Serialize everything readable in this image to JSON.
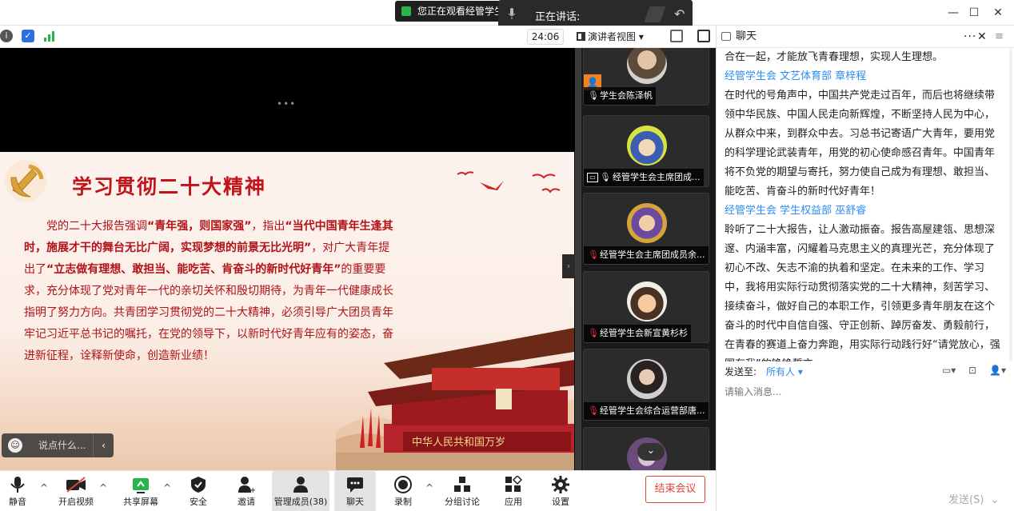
{
  "titlebar": {
    "share_banner": "您正在观看经管学生",
    "speaking_label": "正在讲话:",
    "minimize": "—",
    "maximize": "☐",
    "close": "✕"
  },
  "subbar": {
    "timer": "24:06",
    "speaker_view": "演讲者视图 ▾"
  },
  "slide": {
    "title": "学习贯彻二十大精神",
    "paragraph": [
      {
        "t": "党的二十大报告强调",
        "b": false
      },
      {
        "t": "“青年强，则国家强”",
        "b": true
      },
      {
        "t": "，指出",
        "b": false
      },
      {
        "t": "“当代中国青年生逢其时，施展才干的舞台无比广阔，实现梦想的前景无比光明”",
        "b": true
      },
      {
        "t": "，对广大青年提出了",
        "b": false
      },
      {
        "t": "“立志做有理想、敢担当、能吃苦、肯奋斗的新时代好青年”",
        "b": true
      },
      {
        "t": "的重要要求，充分体现了党对青年一代的亲切关怀和殷切期待，为青年一代健康成长指明了努力方向。共青团学习贯彻党的二十大精神，必须引导广大团员青年牢记习近平总书记的嘱托，在党的领导下，以新时代好青年应有的姿态，奋进新征程，诠释新使命，创造新业绩！",
        "b": false
      }
    ],
    "gate_banner": "中华人民共和国万岁"
  },
  "comment_box": {
    "placeholder": "说点什么...",
    "arrow": "‹"
  },
  "gallery": {
    "participants": [
      {
        "name": "学生会陈泽帆",
        "mic": "on"
      },
      {
        "name": "经管学生会主席团成...",
        "mic": "on"
      },
      {
        "name": "经管学生会主席团成员余...",
        "mic": "off"
      },
      {
        "name": "经管学生会新宣黄杉杉",
        "mic": "off"
      },
      {
        "name": "经管学生会综合运营部唐...",
        "mic": "off"
      }
    ],
    "scroll_down": "⌄"
  },
  "chat": {
    "title": "聊天",
    "messages": [
      {
        "sender": "",
        "text": "合在一起，才能放飞青春理想，实现人生理想。"
      },
      {
        "sender": "经管学生会 文艺体育部 章梓程",
        "text": "在时代的号角声中，中国共产党走过百年，而后也将继续带领中华民族、中国人民走向新辉煌，不断坚持人民为中心，从群众中来，到群众中去。习总书记寄语广大青年，要用党的科学理论武装青年，用党的初心使命感召青年。中国青年将不负党的期望与寄托，努力使自己成为有理想、敢担当、能吃苦、肯奋斗的新时代好青年！"
      },
      {
        "sender": "经管学生会 学生权益部 巫舒睿",
        "text": "聆听了二十大报告，让人激动振奋。报告高屋建瓴、思想深邃、内涵丰富，闪耀着马克思主义的真理光芒，充分体现了初心不改、矢志不渝的执着和坚定。在未来的工作、学习中，我将用实际行动贯彻落实党的二十大精神，刻苦学习、接续奋斗，做好自己的本职工作，引领更多青年朋友在这个奋斗的时代中自信自强、守正创新、踔厉奋发、勇毅前行，在青春的赛道上奋力奔跑，用实际行动践行好“请党放心，强国有我”的铮铮誓言。"
      }
    ],
    "send_to_label": "发送至:",
    "send_to_value": "所有人 ▾",
    "input_placeholder": "请输入消息...",
    "send_label": "发送(S)"
  },
  "toolbar": {
    "mute": "静音",
    "video": "开启视频",
    "share": "共享屏幕",
    "security": "安全",
    "invite": "邀请",
    "members": "管理成员(38)",
    "chat": "聊天",
    "record": "录制",
    "breakout": "分组讨论",
    "apps": "应用",
    "settings": "设置",
    "end": "结束会议"
  },
  "colors": {
    "accent": "#2d8cf0",
    "end_red": "#e0453a",
    "slide_red": "#c1131a"
  }
}
